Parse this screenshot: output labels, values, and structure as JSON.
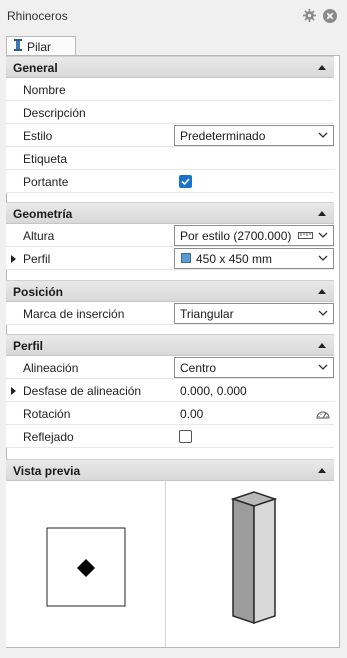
{
  "window": {
    "title": "Rhinoceros"
  },
  "icons": {
    "settings": "gear-icon",
    "close": "close-icon",
    "tab": "column-icon"
  },
  "tab": {
    "label": "Pilar"
  },
  "sections": {
    "general": {
      "title": "General",
      "rows": {
        "nombre": {
          "label": "Nombre",
          "value": ""
        },
        "descripcion": {
          "label": "Descripción",
          "value": ""
        },
        "estilo": {
          "label": "Estilo",
          "value": "Predeterminado"
        },
        "etiqueta": {
          "label": "Etiqueta",
          "value": ""
        },
        "portante": {
          "label": "Portante",
          "checked": true
        }
      }
    },
    "geometria": {
      "title": "Geometría",
      "rows": {
        "altura": {
          "label": "Altura",
          "value": "Por estilo (2700.000)"
        },
        "perfil": {
          "label": "Perfil",
          "value": "450 x 450 mm",
          "swatch_color": "#5b9bd5"
        }
      }
    },
    "posicion": {
      "title": "Posición",
      "rows": {
        "marca": {
          "label": "Marca de inserción",
          "value": "Triangular"
        }
      }
    },
    "perfil": {
      "title": "Perfil",
      "rows": {
        "alineacion": {
          "label": "Alineación",
          "value": "Centro"
        },
        "desfase": {
          "label": "Desfase de alineación",
          "value": "0.000, 0.000"
        },
        "rotacion": {
          "label": "Rotación",
          "value": "0.00"
        },
        "reflejado": {
          "label": "Reflejado",
          "checked": false
        }
      }
    },
    "vista_previa": {
      "title": "Vista previa"
    }
  },
  "colors": {
    "accent": "#1a73c9",
    "header_bg": "#dedede"
  }
}
